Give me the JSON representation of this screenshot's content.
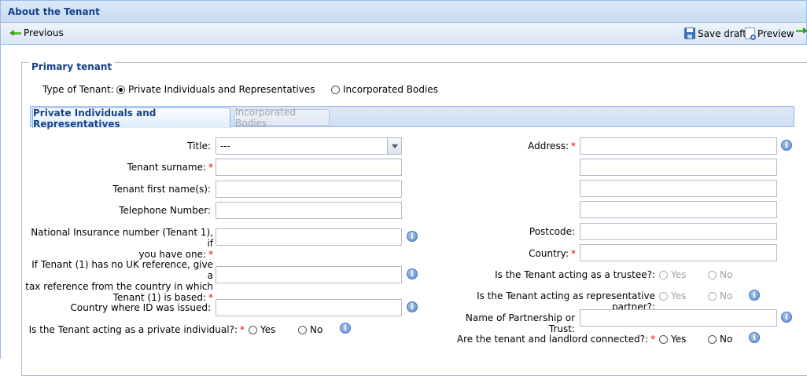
{
  "window": {
    "title": "About the Tenant"
  },
  "toolbar": {
    "previous": "Previous",
    "save_draft": "Save draft",
    "preview": "Preview"
  },
  "fieldset": {
    "legend": "Primary tenant"
  },
  "tenant_type": {
    "label": "Type of Tenant:",
    "options": [
      "Private Individuals and Representatives",
      "Incorporated Bodies"
    ],
    "selected": "Private Individuals and Representatives"
  },
  "tabs": [
    {
      "label": "Private Individuals and Representatives",
      "active": true
    },
    {
      "label": "Incorporated Bodies",
      "active": false
    }
  ],
  "left_form": {
    "title": {
      "label": "Title:",
      "value": "---"
    },
    "surname": {
      "label": "Tenant surname:",
      "required": "*",
      "value": ""
    },
    "first_names": {
      "label": "Tenant first name(s):",
      "value": ""
    },
    "telephone": {
      "label": "Telephone Number:",
      "value": ""
    },
    "ni_number": {
      "label_line1": "National Insurance number (Tenant 1), if",
      "label_line2": "you have one:",
      "required": "*",
      "value": ""
    },
    "tax_ref": {
      "label_line1": "If Tenant (1) has no UK reference, give a",
      "label_line2": "tax reference from the country in which",
      "label_line3": "Tenant (1) is based:",
      "required": "*",
      "value": ""
    },
    "country_id": {
      "label": "Country where ID was issued:",
      "value": ""
    },
    "private_individual": {
      "label": "Is the Tenant acting as a private individual?:",
      "required": "*",
      "yes": "Yes",
      "no": "No"
    }
  },
  "right_form": {
    "address": {
      "label": "Address:",
      "required": "*",
      "lines": [
        "",
        "",
        "",
        ""
      ]
    },
    "postcode": {
      "label": "Postcode:",
      "value": ""
    },
    "country": {
      "label": "Country:",
      "required": "*",
      "value": ""
    },
    "trustee": {
      "label": "Is the Tenant acting as a trustee?:",
      "yes": "Yes",
      "no": "No"
    },
    "rep_partner": {
      "label": "Is the Tenant acting as representative partner?:",
      "yes": "Yes",
      "no": "No"
    },
    "partnership_name": {
      "label": "Name of Partnership or Trust:",
      "value": ""
    },
    "connected": {
      "label": "Are the tenant and landlord connected?:",
      "required": "*",
      "yes": "Yes",
      "no": "No"
    }
  },
  "icons": {
    "info": "i"
  },
  "colors": {
    "header_text": "#15428b",
    "required": "#ee0000",
    "border": "#99bbe8"
  }
}
